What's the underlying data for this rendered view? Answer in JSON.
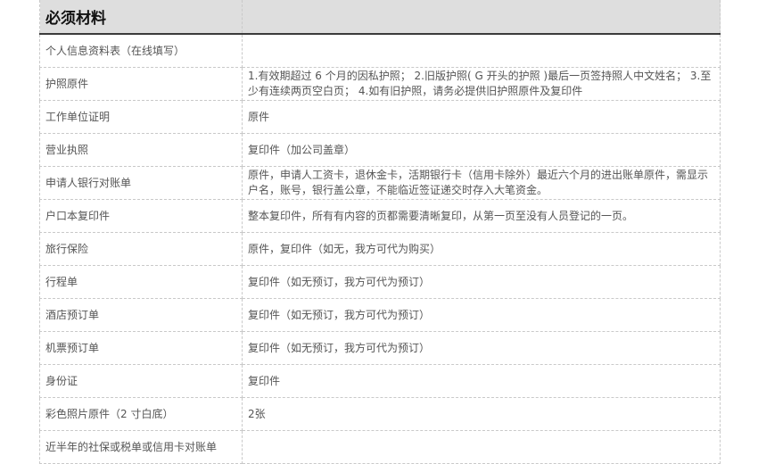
{
  "table": {
    "header": {
      "title": "必须材料",
      "note": ""
    },
    "rows": [
      {
        "item": "个人信息资料表（在线填写）",
        "note": ""
      },
      {
        "item": "护照原件",
        "note": "1.有效期超过 6 个月的因私护照； 2.旧版护照( G 开头的护照 )最后一页签持照人中文姓名； 3.至少有连续两页空白页； 4.如有旧护照，请务必提供旧护照原件及复印件"
      },
      {
        "item": "工作单位证明",
        "note": "原件"
      },
      {
        "item": "营业执照",
        "note": "复印件（加公司盖章）"
      },
      {
        "item": "申请人银行对账单",
        "note": "原件，申请人工资卡，退休金卡，活期银行卡（信用卡除外）最近六个月的进出账单原件，需显示户名，账号，银行盖公章，不能临近签证递交时存入大笔资金。"
      },
      {
        "item": "户口本复印件",
        "note": "整本复印件，所有有内容的页都需要清晰复印，从第一页至没有人员登记的一页。"
      },
      {
        "item": "旅行保险",
        "note": "原件，复印件（如无，我方可代为购买）"
      },
      {
        "item": "行程单",
        "note": "复印件（如无预订，我方可代为预订）"
      },
      {
        "item": "酒店预订单",
        "note": "复印件（如无预订，我方可代为预订）"
      },
      {
        "item": "机票预订单",
        "note": "复印件（如无预订，我方可代为预订）"
      },
      {
        "item": "身份证",
        "note": "复印件"
      },
      {
        "item": "彩色照片原件（2 寸白底）",
        "note": "2张"
      },
      {
        "item": "近半年的社保或税单或信用卡对账单",
        "note": ""
      }
    ]
  }
}
